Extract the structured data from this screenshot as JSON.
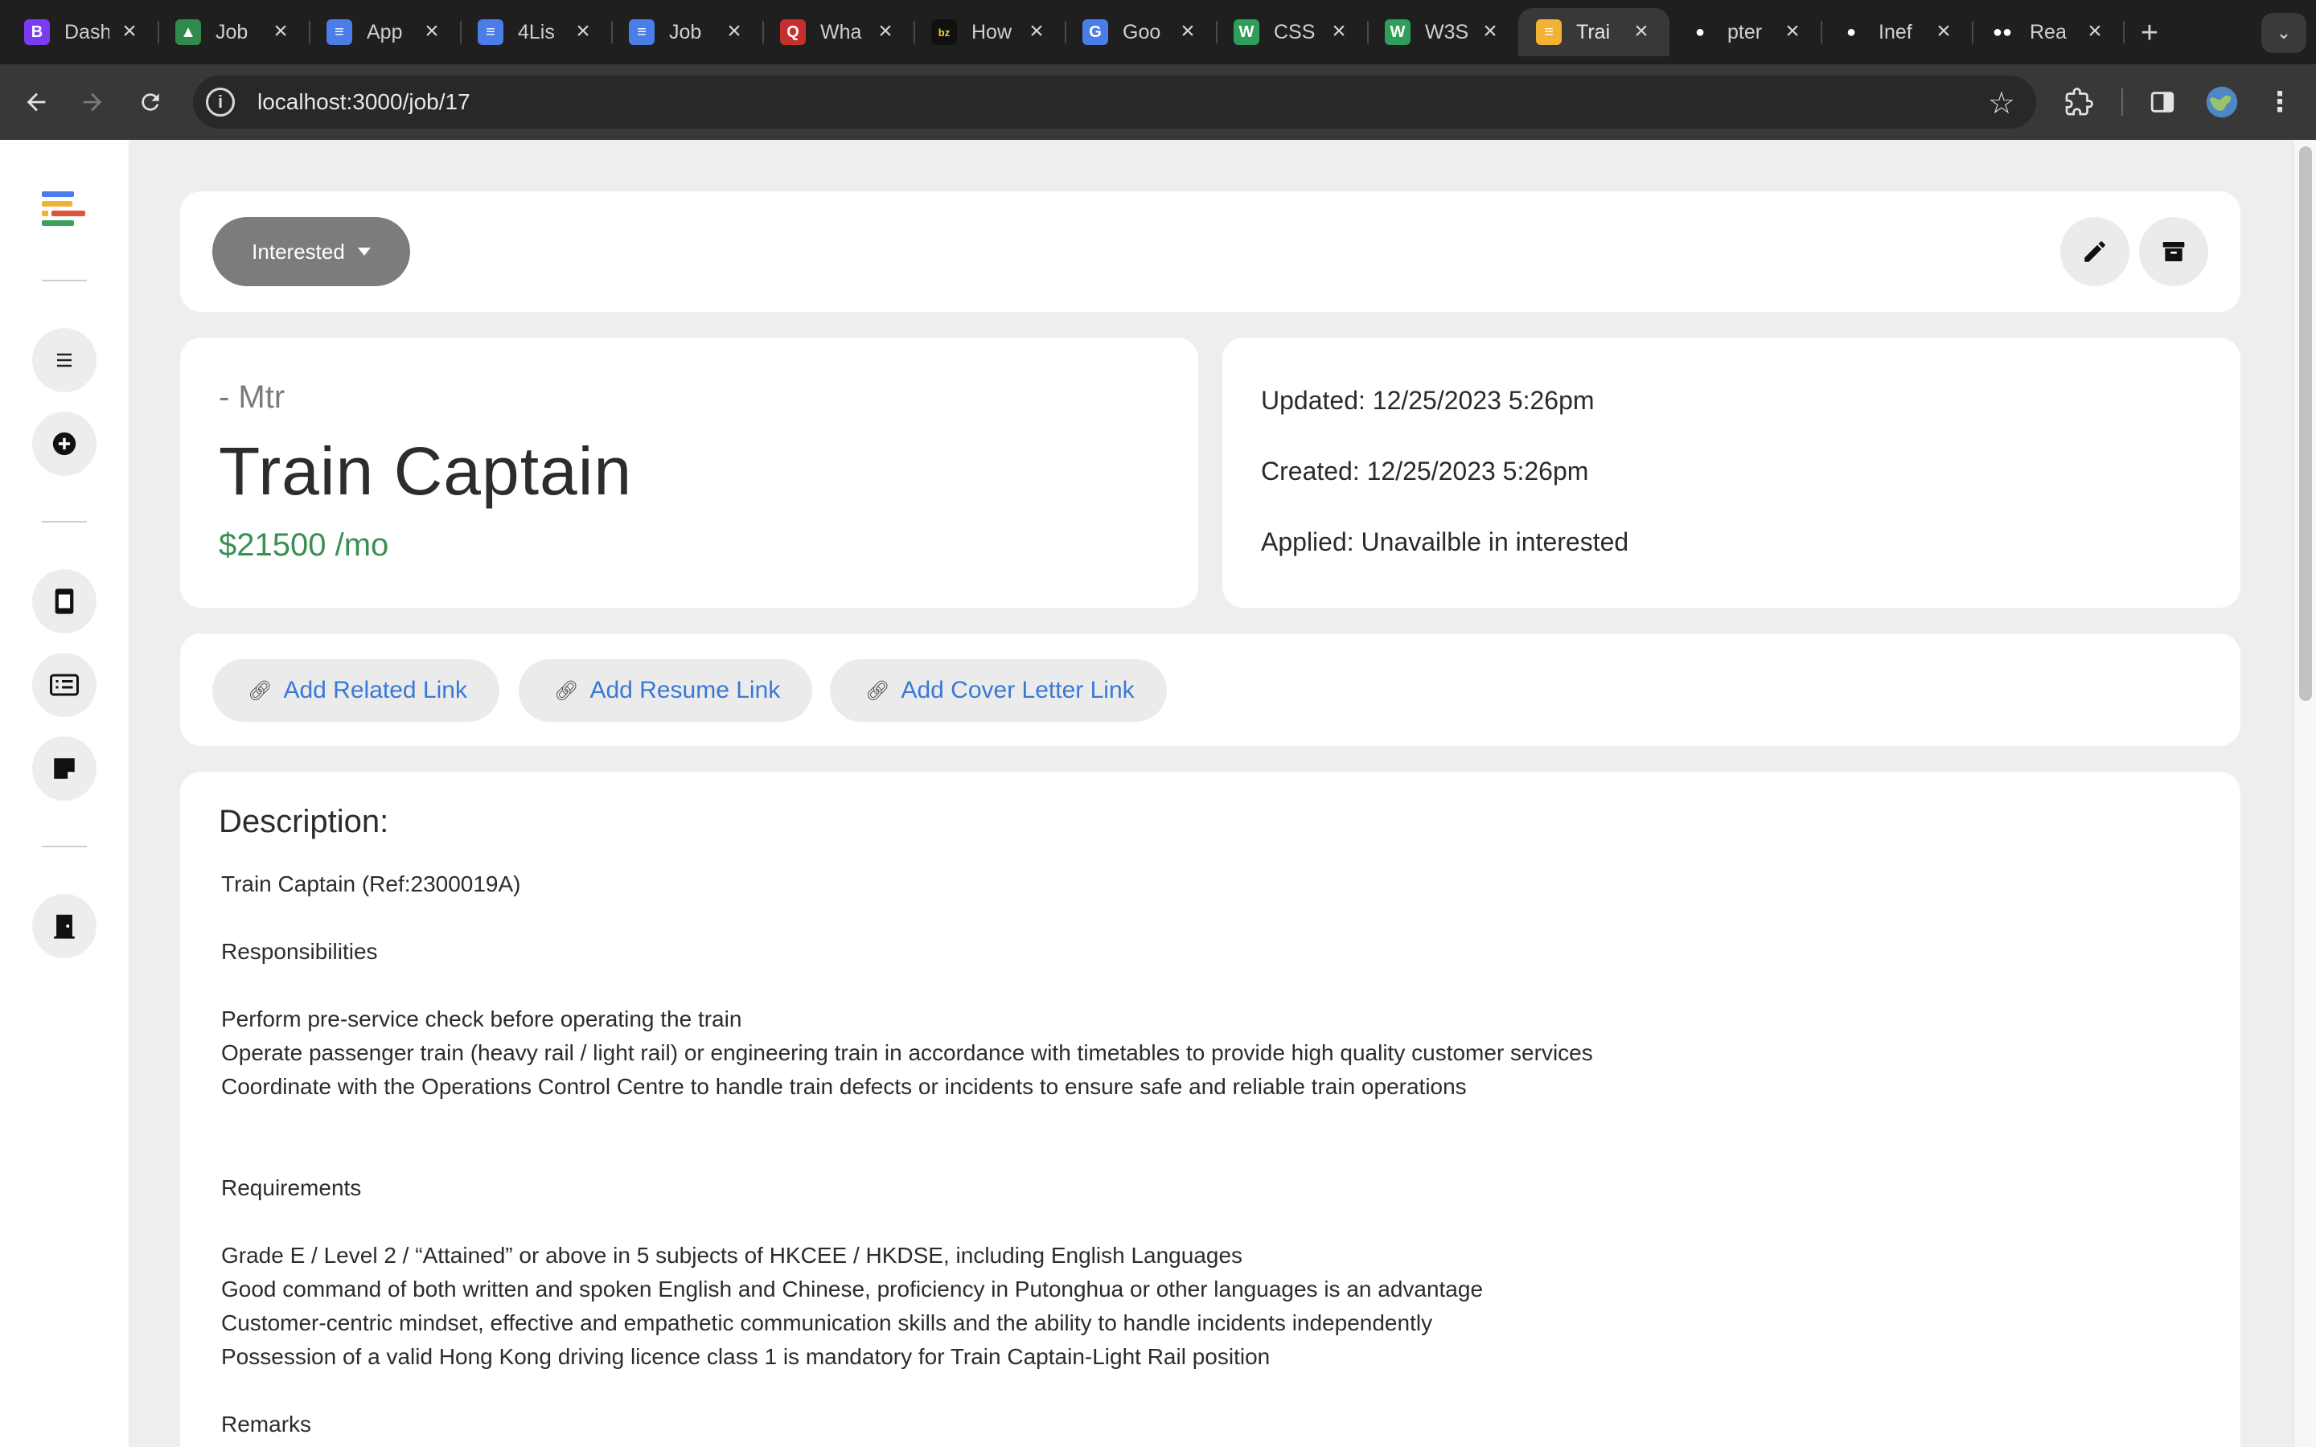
{
  "browser": {
    "tabs": [
      {
        "title": "Dashl",
        "icon": "bootstrap-icon",
        "color": "#7a3cf2",
        "glyph": "B"
      },
      {
        "title": "Job",
        "icon": "google-drive-icon",
        "color": "#2f8a4c",
        "glyph": "▲"
      },
      {
        "title": "App",
        "icon": "google-docs-icon",
        "color": "#4a7de8",
        "glyph": "≡"
      },
      {
        "title": "4Lis",
        "icon": "google-docs-icon",
        "color": "#4a7de8",
        "glyph": "≡"
      },
      {
        "title": "Job",
        "icon": "google-docs-icon",
        "color": "#4a7de8",
        "glyph": "≡"
      },
      {
        "title": "Wha",
        "icon": "quora-icon",
        "color": "#c6302c",
        "glyph": "Q"
      },
      {
        "title": "How",
        "icon": "bz-icon",
        "color": "#111111",
        "glyph": "bz"
      },
      {
        "title": "Goo",
        "icon": "google-translate-icon",
        "color": "#4a7de8",
        "glyph": "G"
      },
      {
        "title": "CSS",
        "icon": "w3schools-icon",
        "color": "#2f9e5a",
        "glyph": "W"
      },
      {
        "title": "W3S",
        "icon": "w3schools-icon",
        "color": "#2f9e5a",
        "glyph": "W"
      },
      {
        "title": "Trai",
        "icon": "app-logo-icon",
        "color": "#f2b233",
        "glyph": "≡",
        "active": true
      },
      {
        "title": "pter",
        "icon": "github-icon",
        "color": "#ffffff",
        "glyph": "●"
      },
      {
        "title": "Inef",
        "icon": "github-icon",
        "color": "#ffffff",
        "glyph": "●"
      },
      {
        "title": "Rea",
        "icon": "medium-icon",
        "color": "#ffffff",
        "glyph": "●●"
      }
    ],
    "url": "localhost:3000/job/17"
  },
  "job": {
    "status": "Interested",
    "company": "- Mtr",
    "title": "Train Captain",
    "salary": "$21500 /mo",
    "updated": "Updated: 12/25/2023 5:26pm",
    "created": "Created: 12/25/2023 5:26pm",
    "applied": "Applied: Unavailble in interested"
  },
  "links": {
    "related": "Add Related Link",
    "resume": "Add Resume Link",
    "cover_letter": "Add Cover Letter Link"
  },
  "description": {
    "heading": "Description:",
    "lines": [
      "Train Captain (Ref:2300019A)",
      "Responsibilities",
      "Perform pre-service check before operating the train",
      "Operate passenger train (heavy rail / light rail) or engineering train in accordance with timetables to provide high quality customer services",
      "Coordinate with the Operations Control Centre to handle train defects or incidents to ensure safe and reliable train operations",
      "Requirements",
      "Grade E / Level 2 / “Attained” or above in 5 subjects of HKCEE / HKDSE, including English Languages",
      "Good command of both written and spoken English and Chinese, proficiency in Putonghua or other languages is an advantage",
      "Customer-centric mindset, effective and empathetic communication skills and the ability to handle incidents independently",
      "Possession of a valid Hong Kong driving licence class 1 is mandatory for Train Captain-Light Rail position",
      "Remarks"
    ]
  },
  "colors": {
    "salary": "#3a8f53",
    "link": "#3979d6",
    "status_button": "#7c7c7c"
  }
}
